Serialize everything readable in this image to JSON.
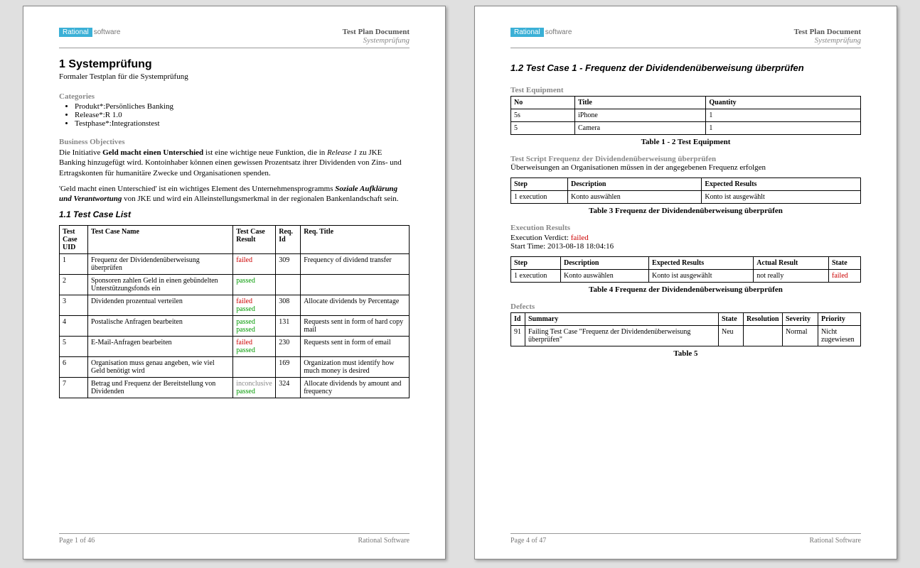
{
  "header": {
    "logo_brand": "Rational",
    "logo_suffix": "software",
    "doc_title": "Test Plan Document",
    "doc_sub": "Systemprüfung"
  },
  "page1": {
    "h1": "1   Systemprüfung",
    "subtitle": "Formaler Testplan für die Systemprüfung",
    "categories_label": "Categories",
    "categories": [
      "Produkt*:Persönliches Banking",
      "Release*:R 1.0",
      "Testphase*:Integrationstest"
    ],
    "business_label": "Business Objectives",
    "para1_a": "Die Initiative ",
    "para1_b": "Geld macht einen Unterschied",
    "para1_c": " ist eine wichtige neue Funktion, die in ",
    "para1_d": "Release 1",
    "para1_e": " zu JKE Banking hinzugefügt wird. Kontoinhaber können einen gewissen Prozentsatz ihrer Dividenden von Zins- und Ertragskonten für humanitäre Zwecke und Organisationen spenden.",
    "para2_a": "'Geld macht einen Unterschied' ist ein wichtiges Element des Unternehmensprogramms ",
    "para2_b": "Soziale Aufklärung und Verantwortung",
    "para2_c": " von JKE und wird ein Alleinstellungsmerkmal in der regionalen Bankenlandschaft sein.",
    "h2": "1.1  Test Case List",
    "table_headers": [
      "Test Case UID",
      "Test Case Name",
      "Test Case Result",
      "Req. Id",
      "Req. Title"
    ],
    "rows": [
      {
        "uid": "1",
        "name": "Frequenz der Dividendenüberweisung überprüfen",
        "results": [
          {
            "v": "failed",
            "c": "failed"
          }
        ],
        "req": "309",
        "title": "Frequency of dividend transfer"
      },
      {
        "uid": "2",
        "name": "Sponsoren zahlen Geld in einen gebündelten Unterstützungsfonds ein",
        "results": [
          {
            "v": "passed",
            "c": "passed"
          }
        ],
        "req": "",
        "title": ""
      },
      {
        "uid": "3",
        "name": "Dividenden prozentual verteilen",
        "results": [
          {
            "v": "failed",
            "c": "failed"
          },
          {
            "v": "passed",
            "c": "passed"
          }
        ],
        "req": "308",
        "title": "Allocate dividends by Percentage"
      },
      {
        "uid": "4",
        "name": "Postalische Anfragen bearbeiten",
        "results": [
          {
            "v": "passed",
            "c": "passed"
          },
          {
            "v": "passed",
            "c": "passed"
          }
        ],
        "req": "131",
        "title": "Requests sent in form of hard copy mail"
      },
      {
        "uid": "5",
        "name": "E-Mail-Anfragen bearbeiten",
        "results": [
          {
            "v": "failed",
            "c": "failed"
          },
          {
            "v": "passed",
            "c": "passed"
          }
        ],
        "req": "230",
        "title": "Requests sent in form of email"
      },
      {
        "uid": "6",
        "name": "Organisation muss genau angeben, wie viel Geld benötigt wird",
        "results": [],
        "req": "169",
        "title": "Organization must identify how much money is desired"
      },
      {
        "uid": "7",
        "name": "Betrag und Frequenz der Bereitstellung von Dividenden",
        "results": [
          {
            "v": "inconclusive",
            "c": "inconclusive"
          },
          {
            "v": "passed",
            "c": "passed"
          }
        ],
        "req": "324",
        "title": "Allocate dividends by amount and frequency"
      }
    ],
    "footer_left": "Page 1 of  46",
    "footer_right": "Rational Software"
  },
  "page2": {
    "h2": "1.2  Test Case 1 - Frequenz der Dividendenüberweisung überprüfen",
    "equipment_label": "Test Equipment",
    "eq_headers": [
      "No",
      "Title",
      "Quantity"
    ],
    "eq_rows": [
      {
        "no": "5s",
        "title": "iPhone",
        "qty": "1"
      },
      {
        "no": "5",
        "title": "Camera",
        "qty": "1"
      }
    ],
    "eq_caption": "Table 1 - 2 Test Equipment",
    "script_label": "Test Script Frequenz der Dividendenüberweisung überprüfen",
    "script_desc": "Überweisungen an Organisationen müssen in der angegebenen Frequenz erfolgen",
    "script_headers": [
      "Step",
      "Description",
      "Expected Results"
    ],
    "script_rows": [
      {
        "step": "1 execution",
        "desc": "Konto auswählen",
        "exp": "Konto ist ausgewählt"
      }
    ],
    "script_caption": "Table 3 Frequenz der Dividendenüberweisung überprüfen",
    "exec_label": "Execution Results",
    "exec_verdict_label": "Execution Verdict: ",
    "exec_verdict": "failed",
    "exec_start": "Start Time: 2013-08-18 18:04:16",
    "exec_headers": [
      "Step",
      "Description",
      "Expected Results",
      "Actual Result",
      "State"
    ],
    "exec_rows": [
      {
        "step": "1 execution",
        "desc": "Konto auswählen",
        "exp": "Konto ist ausgewählt",
        "act": "not really",
        "state": "failed"
      }
    ],
    "exec_caption": "Table 4 Frequenz der Dividendenüberweisung überprüfen",
    "defects_label": "Defects",
    "def_headers": [
      "Id",
      "Summary",
      "State",
      "Resolution",
      "Severity",
      "Priority"
    ],
    "def_rows": [
      {
        "id": "91",
        "summary": "Failing Test Case \"Frequenz der Dividendenüberweisung überprüfen\"",
        "state": "Neu",
        "res": "",
        "sev": "Normal",
        "pri": "Nicht zugewiesen"
      }
    ],
    "def_caption": "Table 5",
    "footer_left": "Page 4 of  47",
    "footer_right": "Rational Software"
  }
}
